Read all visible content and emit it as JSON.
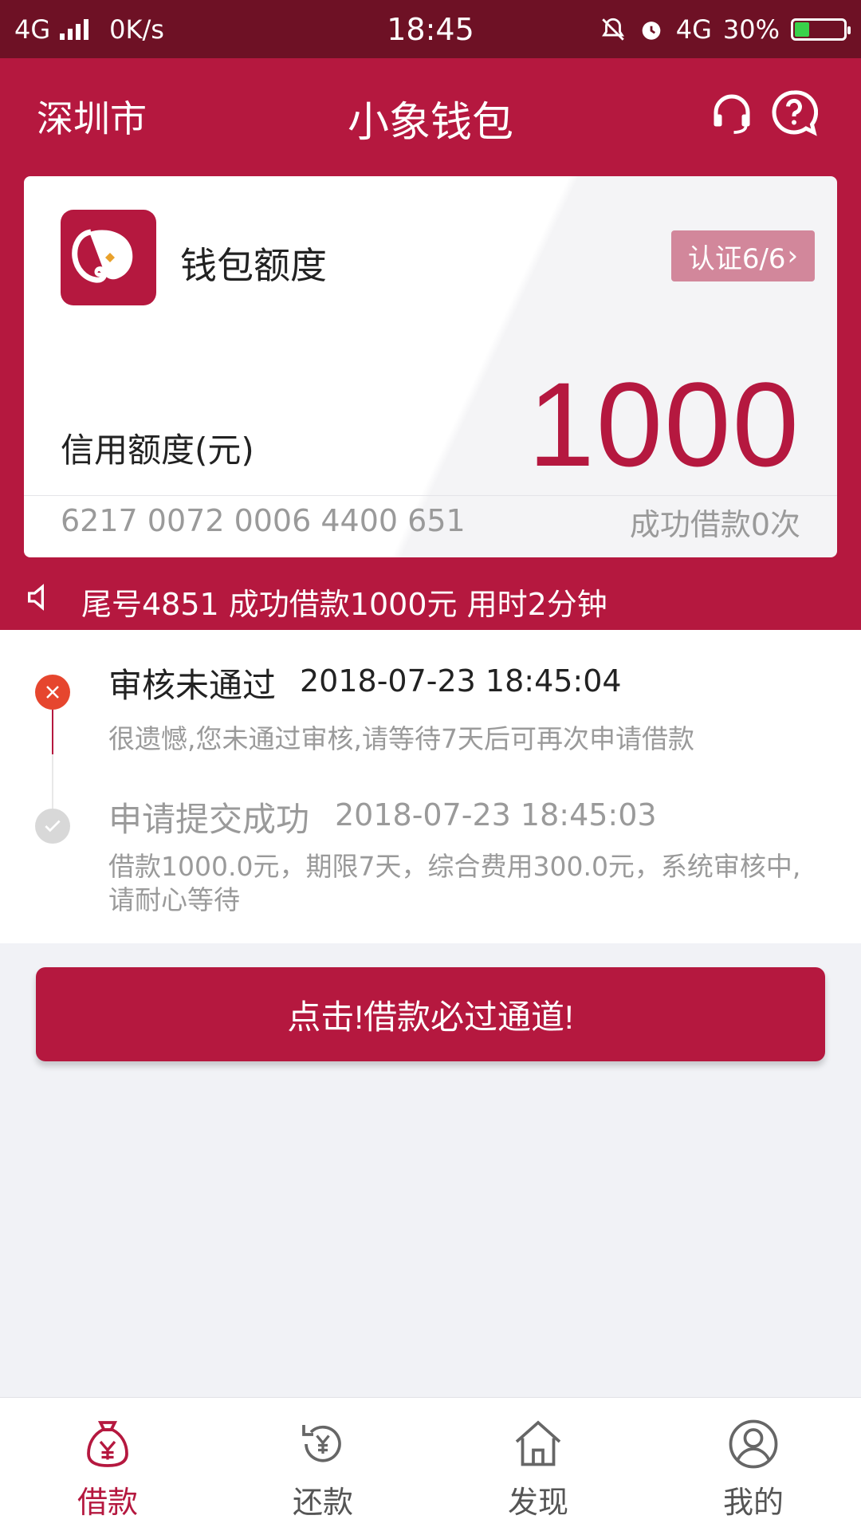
{
  "status_bar": {
    "network": "4G",
    "speed": "0K/s",
    "time": "18:45",
    "network_right": "4G",
    "battery_percent": "30%",
    "battery_level": 0.3
  },
  "header": {
    "city": "深圳市",
    "title": "小象钱包"
  },
  "card": {
    "title": "钱包额度",
    "cert_badge": "认证6/6",
    "credit_label": "信用额度(元)",
    "credit_amount": "1000",
    "card_number": "6217 0072 0006 4400 651",
    "success_count": "成功借款0次"
  },
  "notice": {
    "text": "尾号4851 成功借款1000元 用时2分钟"
  },
  "timeline": [
    {
      "status": "fail",
      "title": "审核未通过",
      "time": "2018-07-23 18:45:04",
      "desc": "很遗憾,您未通过审核,请等待7天后可再次申请借款"
    },
    {
      "status": "ok",
      "title": "申请提交成功",
      "time": "2018-07-23 18:45:03",
      "desc": "借款1000.0元，期限7天，综合费用300.0元，系统审核中,请耐心等待"
    }
  ],
  "cta": {
    "label": "点击!借款必过通道!"
  },
  "tabbar": {
    "items": [
      {
        "label": "借款",
        "icon": "money-bag-icon",
        "active": true
      },
      {
        "label": "还款",
        "icon": "repay-icon",
        "active": false
      },
      {
        "label": "发现",
        "icon": "home-icon",
        "active": false
      },
      {
        "label": "我的",
        "icon": "user-icon",
        "active": false
      }
    ]
  },
  "colors": {
    "brand": "#b5183f",
    "status_bar": "#6e1125",
    "fail": "#e6462e"
  }
}
